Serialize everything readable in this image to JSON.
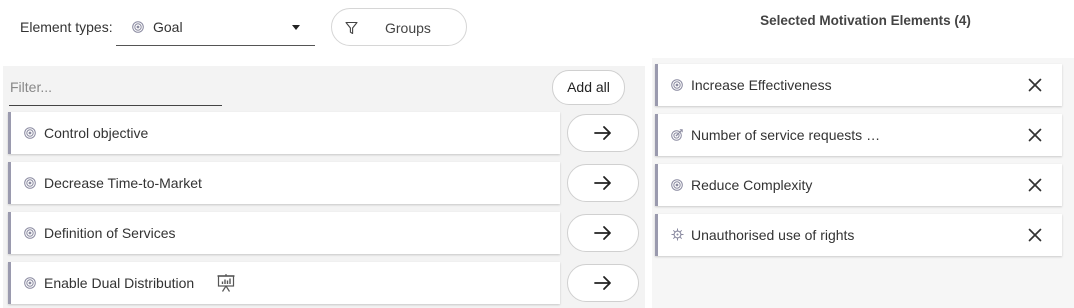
{
  "type_selector": {
    "label": "Element types:",
    "value": "Goal",
    "value_icon": "goal-icon"
  },
  "groups_button": {
    "label": "Groups",
    "icon": "filter-icon"
  },
  "filter": {
    "placeholder": "Filter...",
    "value": ""
  },
  "add_all_label": "Add all",
  "available_items": [
    {
      "label": "Control objective",
      "icon": "goal-icon"
    },
    {
      "label": "Decrease Time-to-Market",
      "icon": "goal-icon"
    },
    {
      "label": "Definition of Services",
      "icon": "goal-icon"
    },
    {
      "label": "Enable Dual Distribution",
      "icon": "goal-icon",
      "extra_icon": "presentation-chart-icon"
    }
  ],
  "selected_panel": {
    "title": "Selected Motivation Elements (4)",
    "items": [
      {
        "label": "Increase Effectiveness",
        "icon": "goal-icon"
      },
      {
        "label": "Number of service requests …",
        "icon": "target-icon"
      },
      {
        "label": "Reduce Complexity",
        "icon": "goal-icon"
      },
      {
        "label": "Unauthorised use of rights",
        "icon": "virus-icon"
      }
    ]
  },
  "colors": {
    "item_accent": "#9a9aae",
    "list_background": "#f3f3f3",
    "icon": "#8a8aa0"
  }
}
